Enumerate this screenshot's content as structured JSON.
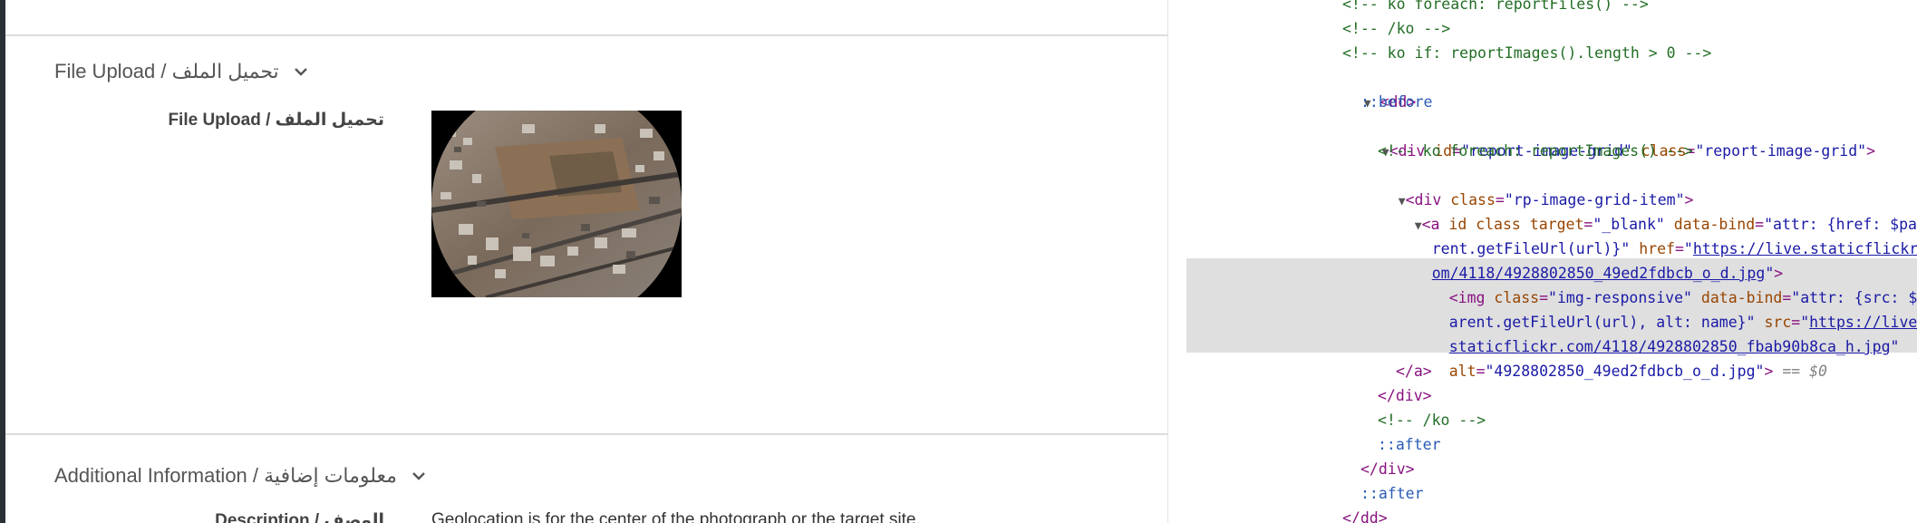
{
  "report": {
    "file_upload_section": {
      "title": "File Upload / تحميل الملف",
      "field_label": "File Upload / تحميل الملف"
    },
    "additional_section": {
      "title": "Additional Information / معلومات إضافية"
    },
    "description": {
      "label": "Description / الوصف",
      "value": "Geolocation is for the center of the photograph or the target site."
    }
  },
  "devtools": {
    "lines": [
      {
        "t": "<!-- ko foreach: reportFiles() -->"
      },
      {
        "t": "<!-- /ko -->"
      },
      {
        "t": "<!-- ko if: reportImages().length > 0 -->"
      },
      {
        "t": "<dd>"
      },
      {
        "t": "::before"
      },
      {
        "t1": "<div ",
        "a1": "id",
        "v1": "\"report-image-grid\"",
        "a2": "class",
        "v2": "\"report-image-grid\"",
        "t2": ">"
      },
      {
        "t": "<!-- ko foreach: reportImages() -->"
      },
      {
        "t1": "<div ",
        "a1": "class",
        "v1": "\"rp-image-grid-item\"",
        "t2": ">"
      },
      {
        "p1": "<a ",
        "p2": "id class ",
        "p3": "target",
        "p4": "\"_blank\"",
        "p5": "data-bind",
        "p6": "\"attr: {href: $pa"
      },
      {
        "p1": "rent.getFileUrl(url)}\"",
        "p2": "href",
        "p3": "\"",
        "p4": "https://live.staticflickr.c"
      },
      {
        "p1": "om/4118/4928802850_49ed2fdbcb_o_d.jpg",
        "p2": "\"",
        "p3": ">"
      },
      {
        "p1": "<img ",
        "p2": "class",
        "p3": "\"img-responsive\"",
        "p4": "data-bind",
        "p5": "\"attr: {src: $p"
      },
      {
        "p1": "arent.getFileUrl(url), alt: name}\"",
        "p2": "src",
        "p3": "\"",
        "p4": "https://live."
      },
      {
        "p1": "staticflickr.com/4118/4928802850_fbab90b8ca_h.jpg",
        "p2": "\""
      },
      {
        "p1": "alt",
        "p2": "\"4928802850_49ed2fdbcb_o_d.jpg\"",
        "p3": ">",
        "p4": " == $0"
      },
      {
        "t": "</a>"
      },
      {
        "t": "</div>"
      },
      {
        "t": "<!-- /ko -->"
      },
      {
        "t": "::after"
      },
      {
        "t": "</div>"
      },
      {
        "t": "::after"
      },
      {
        "t": "</dd>"
      }
    ]
  },
  "icons": {
    "chevron": "chevron-down-icon",
    "disclosure_triangle": "disclosure-triangle-icon"
  },
  "colors": {
    "comment": "#236e25",
    "tag": "#881280",
    "attr_name": "#994500",
    "attr_value": "#1a1aa6",
    "selected_row": "#dfdfdf",
    "sidebar": "#2b2f36"
  }
}
